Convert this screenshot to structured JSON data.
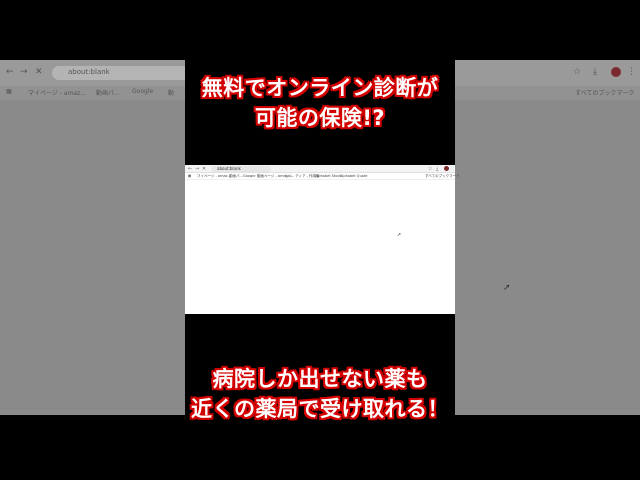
{
  "background_browser": {
    "url": "about:blank",
    "nav_icons": [
      "←",
      "→",
      "✕"
    ],
    "bookmarks": [
      "マイページ - amaz...",
      "動画パ...",
      "Google",
      "動"
    ],
    "right_bookmark": "すべてのブックマーク",
    "right_icons": [
      "☆",
      "⤓",
      "⋮"
    ]
  },
  "headline_top": {
    "line1": "無料でオンライン診断が",
    "line2": "可能の保険!?"
  },
  "headline_bottom": {
    "line1": "病院しか出せない薬も",
    "line2": "近くの薬局で受け取れる！"
  },
  "mini_browser": {
    "url": "about:blank",
    "bookmarks": [
      "マイページ - amaz...",
      "動画パ...",
      "Google",
      "動画ページ - amazo...",
      "しつ - ディア - 作成者",
      "Alphabet Stock",
      "Alphabet Quote"
    ],
    "right_bookmark": "すべてのブックマーク"
  },
  "colors": {
    "outline_red": "#d40000",
    "text_white": "#ffffff",
    "background": "#000000",
    "side_panel_gray": "#8a8a8a"
  }
}
